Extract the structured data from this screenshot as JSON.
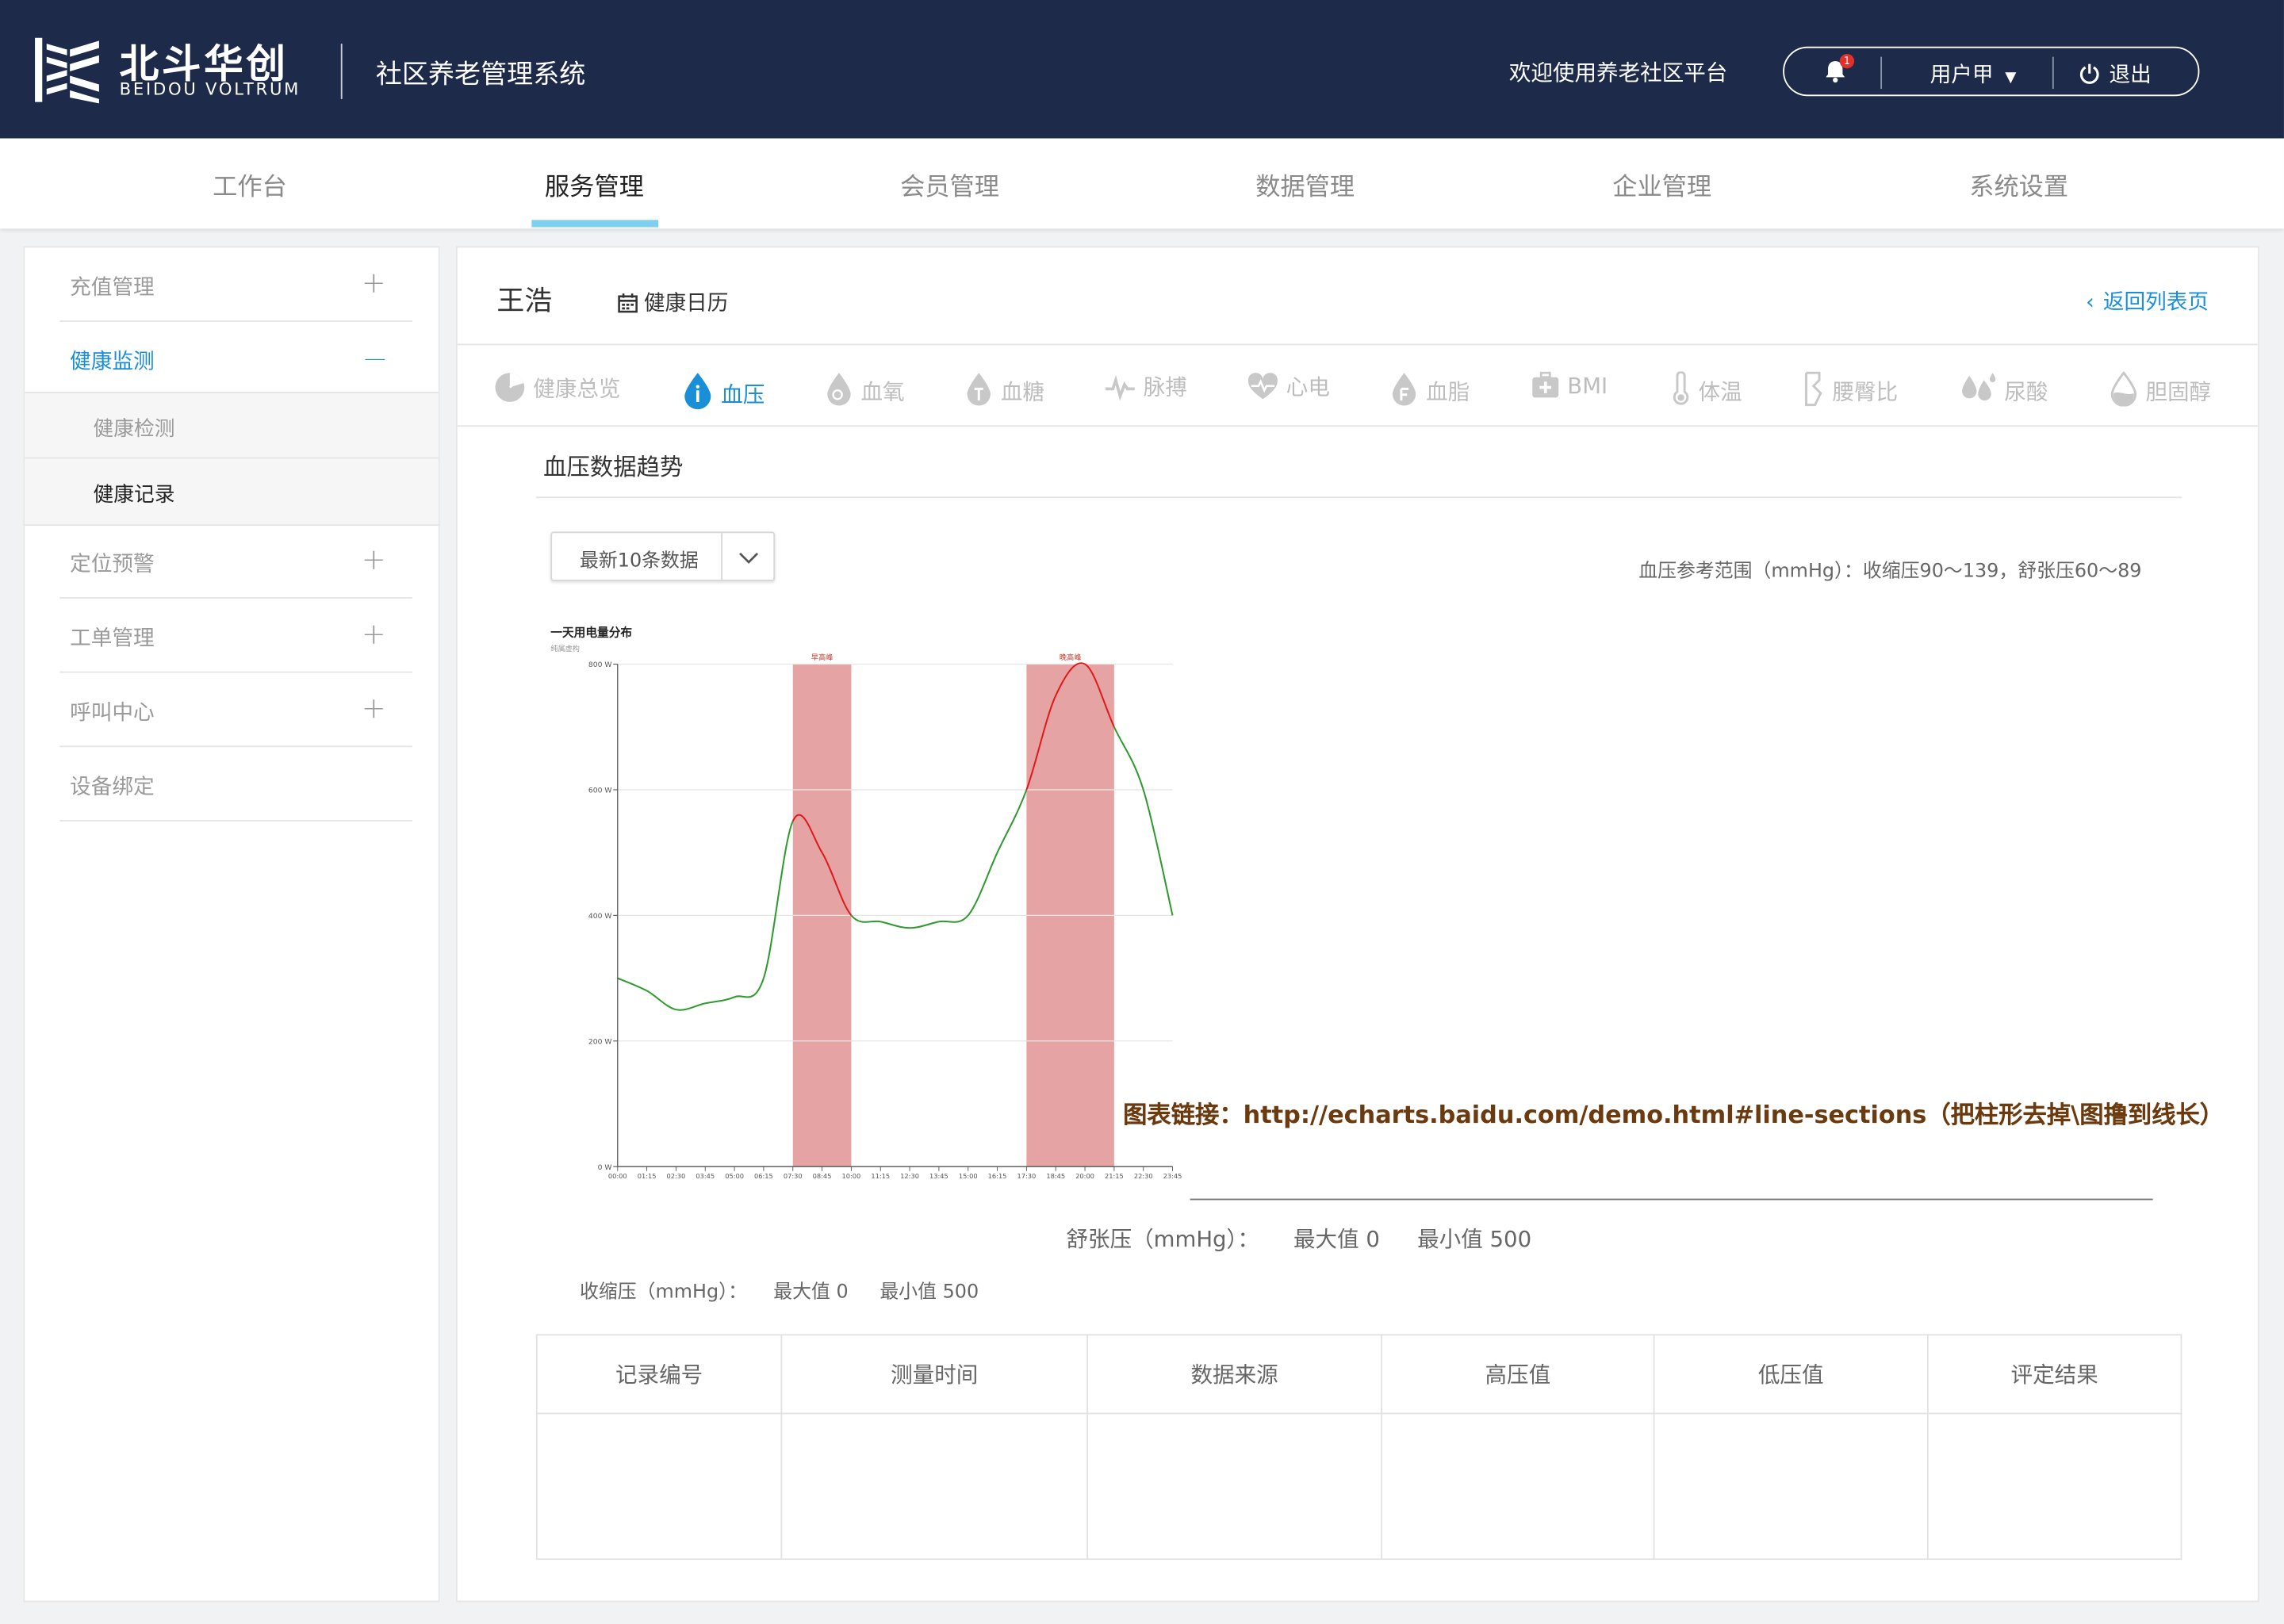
{
  "header": {
    "brand_cn": "北斗华创",
    "brand_en": "BEIDOU VOLTRUM",
    "system_title": "社区养老管理系统",
    "welcome": "欢迎使用养老社区平台",
    "notification_count": "1",
    "username": "用户甲",
    "logout": "退出"
  },
  "nav": {
    "items": [
      "工作台",
      "服务管理",
      "会员管理",
      "数据管理",
      "企业管理",
      "系统设置"
    ],
    "active": "服务管理"
  },
  "sidebar": {
    "items": [
      "充值管理",
      "健康监测",
      "定位预警",
      "工单管理",
      "呼叫中心",
      "设备绑定"
    ],
    "sub_items": [
      "健康检测",
      "健康记录"
    ],
    "plus": "+",
    "minus": "—"
  },
  "main": {
    "person_name": "王浩",
    "calendar_link": "健康日历",
    "back_link": "返回列表页",
    "tabs": [
      "健康总览",
      "血压",
      "血氧",
      "血糖",
      "脉搏",
      "心电",
      "血脂",
      "BMI",
      "体温",
      "腰臀比",
      "尿酸",
      "胆固醇"
    ],
    "active_tab": "血压",
    "section_title": "血压数据趋势",
    "select_value": "最新10条数据",
    "reference_range": "血压参考范围（mmHg）：收缩压90～139，舒张压60～89",
    "annotation": "图表链接：http://echarts.baidu.com/demo.html#line-sections（把柱形去掉\\图撸到线长）",
    "diastolic": {
      "label": "舒张压（mmHg）：",
      "max": "最大值 0",
      "min": "最小值 500"
    },
    "systolic": {
      "label": "收缩压（mmHg）：",
      "max": "最大值 0",
      "min": "最小值 500"
    },
    "table_headers": [
      "记录编号",
      "测量时间",
      "数据来源",
      "高压值",
      "低压值",
      "评定结果"
    ]
  },
  "chart_data": {
    "type": "line",
    "title": "一天用电量分布",
    "subtitle": "纯属虚构",
    "x": [
      "00:00",
      "01:15",
      "02:30",
      "03:45",
      "05:00",
      "06:15",
      "07:30",
      "08:45",
      "10:00",
      "11:15",
      "12:30",
      "13:45",
      "15:00",
      "16:15",
      "17:30",
      "18:45",
      "20:00",
      "21:15",
      "22:30",
      "23:45"
    ],
    "series": [
      {
        "values": [
          300,
          280,
          250,
          260,
          270,
          300,
          550,
          500,
          400,
          390,
          380,
          390,
          400,
          500,
          600,
          750,
          800,
          700,
          600,
          400
        ]
      }
    ],
    "y_tick_labels": [
      "0 W",
      "200 W",
      "400 W",
      "600 W",
      "800 W"
    ],
    "ylim": [
      0,
      800
    ],
    "mark_areas": [
      {
        "name": "早高峰",
        "from": "07:30",
        "to": "10:00"
      },
      {
        "name": "晚高峰",
        "from": "17:30",
        "to": "21:15"
      }
    ],
    "colors": {
      "normal": "#2e9a2e",
      "peak": "#e0191b",
      "area": "#e6a3a3"
    },
    "grid": true
  },
  "colors": {
    "header_bg": "#1e2a4a",
    "accent": "#1a8fd8",
    "nav_underline": "#7fd0ef",
    "annotation": "#6b3a0f"
  }
}
